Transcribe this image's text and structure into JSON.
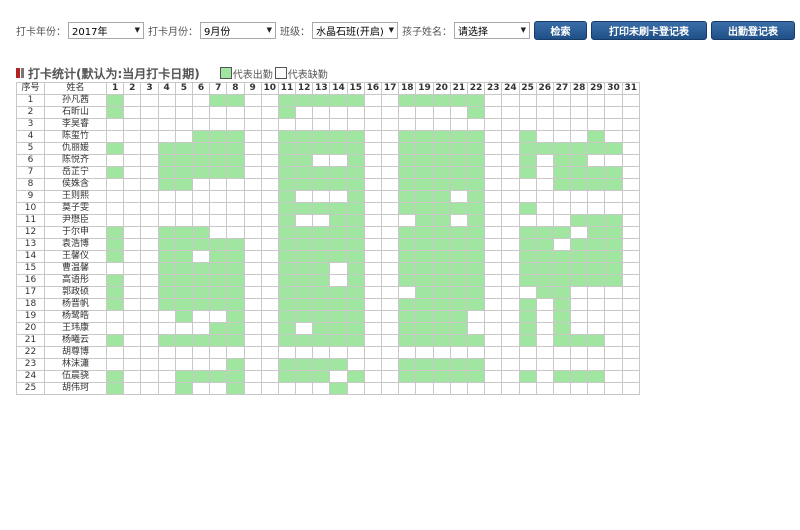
{
  "filters": {
    "year_label": "打卡年份：",
    "year_value": "2017年",
    "month_label": "打卡月份：",
    "month_value": "9月份",
    "class_label": "班级：",
    "class_value": "水晶石班(开启)",
    "child_label": "孩子姓名：",
    "child_value": "请选择"
  },
  "buttons": {
    "search": "检索",
    "print_unswiped": "打印未刷卡登记表",
    "print_attendance": "出勤登记表"
  },
  "section": {
    "title": "打卡统计(默认为:当月打卡日期)",
    "legend_present": "代表出勤",
    "legend_absent": "代表缺勤"
  },
  "colors": {
    "present": "#a0e6a0",
    "absent": "#ffffff",
    "button": "#2a5d96",
    "title_accent": "#b22222"
  },
  "table": {
    "header_index": "序号",
    "header_name": "姓名",
    "days": [
      "1",
      "2",
      "3",
      "4",
      "5",
      "6",
      "7",
      "8",
      "9",
      "10",
      "11",
      "12",
      "13",
      "14",
      "15",
      "16",
      "17",
      "18",
      "19",
      "20",
      "21",
      "22",
      "23",
      "24",
      "25",
      "26",
      "27",
      "28",
      "29",
      "30",
      "31"
    ],
    "rows": [
      {
        "index": "1",
        "name": "孙凡茜",
        "present": [
          1,
          7,
          8,
          11,
          12,
          13,
          14,
          15,
          18,
          19,
          20,
          21,
          22
        ]
      },
      {
        "index": "2",
        "name": "石昕山",
        "present": [
          1,
          11,
          22
        ]
      },
      {
        "index": "3",
        "name": "李昊睿",
        "present": []
      },
      {
        "index": "4",
        "name": "陈玺竹",
        "present": [
          6,
          7,
          8,
          11,
          12,
          13,
          14,
          15,
          18,
          19,
          20,
          21,
          22,
          25,
          29
        ]
      },
      {
        "index": "5",
        "name": "仇丽媛",
        "present": [
          1,
          4,
          5,
          6,
          7,
          8,
          11,
          12,
          13,
          14,
          15,
          18,
          19,
          20,
          21,
          22,
          25,
          26,
          27,
          28,
          29,
          30
        ]
      },
      {
        "index": "6",
        "name": "陈悦齐",
        "present": [
          4,
          5,
          6,
          7,
          8,
          11,
          12,
          15,
          18,
          19,
          20,
          21,
          22,
          25,
          27,
          28
        ]
      },
      {
        "index": "7",
        "name": "岳芷宁",
        "present": [
          1,
          4,
          5,
          6,
          7,
          8,
          11,
          12,
          13,
          14,
          15,
          18,
          19,
          20,
          21,
          22,
          25,
          27,
          28,
          29,
          30
        ]
      },
      {
        "index": "8",
        "name": "侯姝含",
        "present": [
          4,
          5,
          11,
          12,
          13,
          14,
          15,
          18,
          19,
          20,
          21,
          22,
          27,
          28,
          29,
          30
        ]
      },
      {
        "index": "9",
        "name": "王则熙",
        "present": [
          11,
          15,
          18,
          19,
          20,
          22
        ]
      },
      {
        "index": "10",
        "name": "莫子雯",
        "present": [
          11,
          12,
          13,
          14,
          15,
          18,
          19,
          20,
          21,
          22,
          25
        ]
      },
      {
        "index": "11",
        "name": "尹懋臣",
        "present": [
          11,
          14,
          15,
          19,
          20,
          22,
          28,
          29,
          30
        ]
      },
      {
        "index": "12",
        "name": "于尔申",
        "present": [
          1,
          4,
          5,
          6,
          11,
          12,
          13,
          14,
          15,
          18,
          19,
          20,
          21,
          22,
          25,
          26,
          27,
          29,
          30
        ]
      },
      {
        "index": "13",
        "name": "袁浩博",
        "present": [
          1,
          4,
          5,
          6,
          7,
          8,
          11,
          12,
          13,
          14,
          15,
          18,
          19,
          20,
          21,
          22,
          25,
          26,
          28,
          29,
          30
        ]
      },
      {
        "index": "14",
        "name": "王馨仪",
        "present": [
          1,
          4,
          5,
          7,
          8,
          11,
          12,
          13,
          14,
          15,
          18,
          19,
          20,
          21,
          22,
          25,
          26,
          27,
          28,
          29,
          30
        ]
      },
      {
        "index": "15",
        "name": "曹温馨",
        "present": [
          4,
          5,
          6,
          7,
          8,
          11,
          12,
          13,
          15,
          18,
          19,
          20,
          21,
          22,
          25,
          26,
          27,
          28,
          29,
          30
        ]
      },
      {
        "index": "16",
        "name": "高语彤",
        "present": [
          1,
          4,
          5,
          6,
          7,
          8,
          11,
          12,
          13,
          15,
          18,
          19,
          20,
          21,
          22,
          25,
          26,
          27,
          28,
          29,
          30
        ]
      },
      {
        "index": "17",
        "name": "郭政硕",
        "present": [
          1,
          4,
          5,
          6,
          7,
          8,
          11,
          12,
          13,
          14,
          15,
          19,
          20,
          21,
          22,
          26,
          27
        ]
      },
      {
        "index": "18",
        "name": "杨晋帆",
        "present": [
          1,
          4,
          5,
          6,
          7,
          8,
          11,
          12,
          13,
          14,
          15,
          18,
          19,
          20,
          21,
          22,
          25,
          27
        ]
      },
      {
        "index": "19",
        "name": "杨鹭皓",
        "present": [
          5,
          8,
          11,
          12,
          13,
          14,
          15,
          18,
          19,
          20,
          21,
          25,
          27
        ]
      },
      {
        "index": "20",
        "name": "王玮康",
        "present": [
          7,
          8,
          11,
          13,
          14,
          15,
          18,
          19,
          20,
          21,
          25,
          27
        ]
      },
      {
        "index": "21",
        "name": "杨曦云",
        "present": [
          1,
          4,
          5,
          6,
          7,
          8,
          11,
          12,
          13,
          14,
          15,
          18,
          19,
          20,
          21,
          22,
          25,
          27,
          28,
          29
        ]
      },
      {
        "index": "22",
        "name": "胡尊博",
        "present": []
      },
      {
        "index": "23",
        "name": "林沫瀟",
        "present": [
          8,
          11,
          12,
          13,
          14,
          18,
          19,
          20,
          21,
          22
        ]
      },
      {
        "index": "24",
        "name": "伍晨骁",
        "present": [
          1,
          5,
          6,
          7,
          8,
          11,
          12,
          13,
          15,
          18,
          19,
          20,
          21,
          22,
          25,
          27,
          28,
          29
        ]
      },
      {
        "index": "25",
        "name": "胡伟珂",
        "present": [
          1,
          5,
          8,
          14
        ]
      }
    ]
  }
}
